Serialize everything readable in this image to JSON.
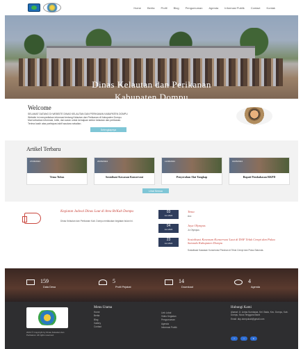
{
  "nav": {
    "items": [
      "Home",
      "Berita",
      "Profil",
      "Blog",
      "Pengumuman",
      "Agenda",
      "Informasi Publik",
      "Contact",
      "Kontak"
    ]
  },
  "hero": {
    "title_line1": "Dinas Kelautan dan Perikanan",
    "title_line2": "Kabupaten Dompu"
  },
  "welcome": {
    "heading": "Welcome",
    "text_1": "SELAMAT DATANG DI WEBSITE DINAS KELAUTAN DAN PERIKANAN KABUPATEN DOMPU",
    "text_2": "Website ini menyediakan informasi tentang Kelautan dan Perikanan di Kabupaten Dompu.",
    "text_3": "Mari sebarkan informasi, kritik, dan saran untuk kemajuan sektor kelautan dan perikanan.",
    "text_4": "Terima kasih atas partisipasi aktif saudara sekalian.",
    "button": "Selengkapnya"
  },
  "articles": {
    "heading": "Artikel Terbaru",
    "cards": [
      {
        "date": "27/06/2024",
        "title": "Tema Tubas"
      },
      {
        "date": "26/06/2024",
        "title": "Sosialisasi Kawasan Konservasi"
      },
      {
        "date": "11/06/2024",
        "title": "Penyerahan Alat Tangkap"
      },
      {
        "date": "16/05/2024",
        "title": "Bupati Pembahasan RKPD"
      }
    ],
    "button": "Lihat Semua"
  },
  "agenda": {
    "title": "Kegiatan Jadwal Dinas Laut di Area Rt/Kab Dompu",
    "text": "Dinas Kelautan dan Perikanan Kab. Dompu melakukan kegiatan bulan ini.",
    "events": [
      {
        "day": "03",
        "month": "Jun 2024",
        "title": "Tema",
        "desc": "Acc"
      },
      {
        "day": "04",
        "month": "Jun 2024",
        "title": "Jaya Olympus",
        "desc": "Jo Olympus"
      },
      {
        "day": "23",
        "month": "Jun 2024",
        "title": "Sosialisasi Kawasan Konservasi Laut di DAF Teluk Cempi dan Pulau Satonda Kabupaten Dompu",
        "desc": "Sosialisasi Kawasan Konservasi Perairan di Teluk Cempi dan Pulau Satonda."
      }
    ]
  },
  "stats": [
    {
      "number": "159",
      "label": "Data Desa"
    },
    {
      "number": "5",
      "label": "Profil Pejabat"
    },
    {
      "number": "14",
      "label": "Download"
    },
    {
      "number": "4",
      "label": "Agenda"
    }
  ],
  "footer": {
    "copyright": "2024 © Copyright by Dinas Kelautan dan Perikanan. All rights reserved.",
    "menu_heading": "Menu Utama",
    "menu_col1": [
      "Home",
      "Berita",
      "Blog",
      "Gallery",
      "Contact"
    ],
    "menu_col2": [
      "Link Lokal",
      "Video Kegiatan",
      "Pengumuman",
      "Agenda",
      "Informasi Publik"
    ],
    "contact_heading": "Hubungi Kami",
    "contact_address": "Alamat: Jl. Lintas Sumbawa, Kel. Bada, Kec. Dompu, Kab. Dompu, Nusa Tenggara Barat",
    "contact_email": "Email: dkp.dompukab@gmail.com",
    "social": [
      "f",
      "t",
      "in"
    ]
  }
}
